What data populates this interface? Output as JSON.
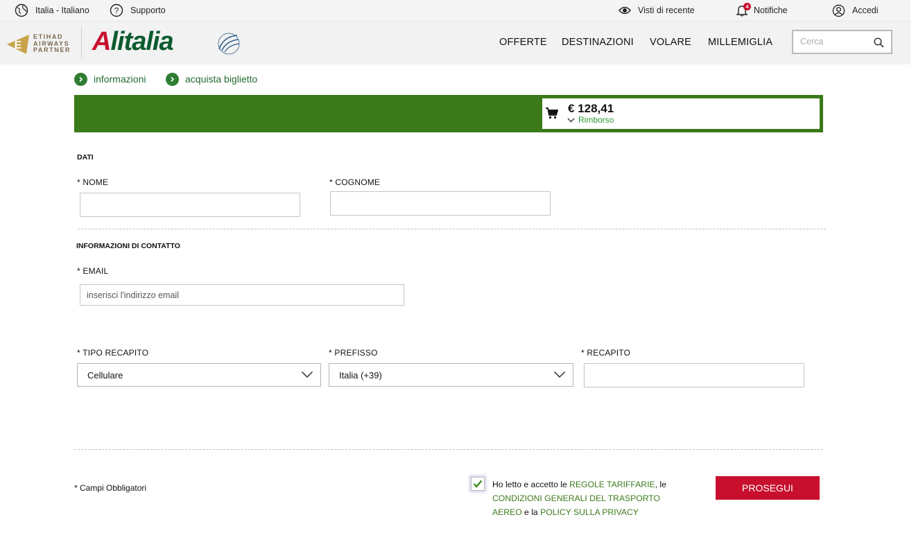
{
  "utility_bar": {
    "language": "Italia - Italiano",
    "support": "Supporto",
    "recently_viewed": "Visti di recente",
    "notifications": "Notifiche",
    "notifications_count": "4",
    "login": "Accedi"
  },
  "header": {
    "partner_logo_text": "ETIHAD AIRWAYS PARTNER",
    "brand_logo_text": "Alitalia",
    "alliance_logo_text": "SKYTEAM",
    "nav": [
      "OFFERTE",
      "DESTINAZIONI",
      "VOLARE",
      "MILLEMIGLIA"
    ],
    "search_placeholder": "Cerca"
  },
  "steps": [
    "informazioni",
    "acquista biglietto"
  ],
  "cart": {
    "price": "€ 128,41",
    "refund_label": "Rimborso"
  },
  "form": {
    "section_data_title": "DATI",
    "first_name_label": "* NOME",
    "last_name_label": "* COGNOME",
    "section_contact_title": "INFORMAZIONI DI CONTATTO",
    "email_label": "* EMAIL",
    "email_placeholder": "inserisci l'indirizzo email",
    "contact_type_label": "* TIPO RECAPITO",
    "contact_type_value": "Cellulare",
    "prefix_label": "* PREFISSO",
    "prefix_value": "Italia (+39)",
    "contact_label": "* RECAPITO"
  },
  "footer": {
    "required_note": "* Campi Obbligatori",
    "consent_prefix": "Ho letto e accetto le ",
    "consent_link_1": "REGOLE TARIFFARIE",
    "consent_mid_1": ", le ",
    "consent_link_2": "CONDIZIONI GENERALI DEL TRASPORTO AEREO",
    "consent_mid_2": " e la ",
    "consent_link_3": "POLICY SULLA PRIVACY",
    "consent_checked": true,
    "continue_button": "PROSEGUI"
  },
  "colors": {
    "brand_green": "#3b7a1a",
    "link_green": "#3d7a1e",
    "brand_red": "#c8102e"
  }
}
